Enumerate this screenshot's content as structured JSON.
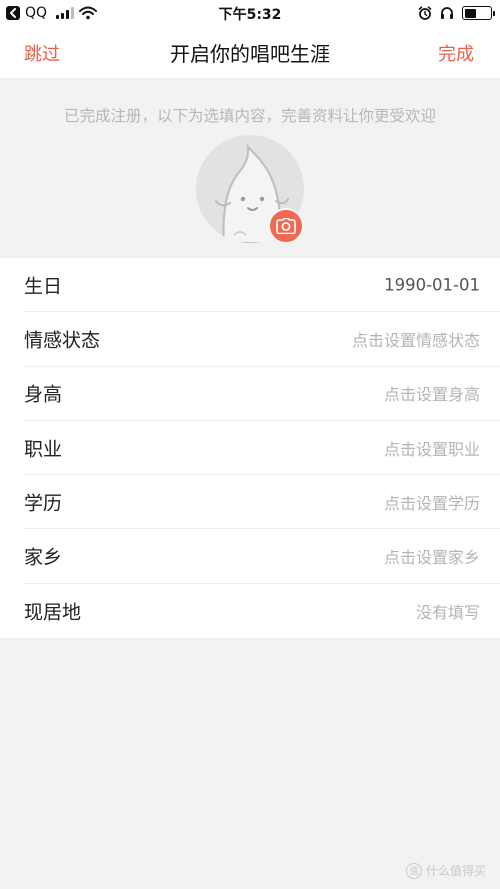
{
  "status_bar": {
    "carrier": "QQ",
    "time": "下午5:32",
    "icons": [
      "back-to-app-icon",
      "cellular-signal-icon",
      "wifi-icon",
      "alarm-icon",
      "headphones-icon",
      "battery-icon"
    ],
    "battery_level": 0.45
  },
  "nav": {
    "skip_label": "跳过",
    "title": "开启你的唱吧生涯",
    "done_label": "完成",
    "accent_color": "#e8604c"
  },
  "header": {
    "hint": "已完成注册，以下为选填内容，完善资料让你更受欢迎",
    "avatar_icon": "default-avatar-icon",
    "camera_icon": "camera-icon"
  },
  "profile_rows": [
    {
      "label": "生日",
      "value": "1990-01-01"
    },
    {
      "label": "情感状态",
      "value": "点击设置情感状态"
    },
    {
      "label": "身高",
      "value": "点击设置身高"
    },
    {
      "label": "职业",
      "value": "点击设置职业"
    },
    {
      "label": "学历",
      "value": "点击设置学历"
    },
    {
      "label": "家乡",
      "value": "点击设置家乡"
    },
    {
      "label": "现居地",
      "value": "没有填写"
    }
  ],
  "watermark": {
    "text": "什么值得买",
    "badge": "值"
  }
}
